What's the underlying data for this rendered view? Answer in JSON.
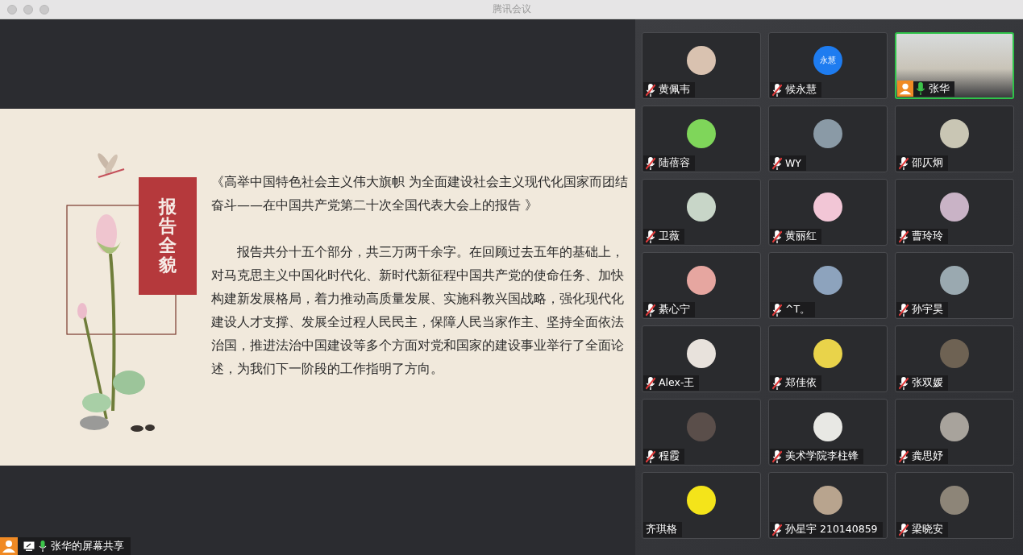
{
  "window": {
    "title": "腾讯会议"
  },
  "slide": {
    "heading": "报告全貌",
    "title": "《高举中国特色社会主义伟大旗帜 为全面建设社会主义现代化国家而团结奋斗——在中国共产党第二十次全国代表大会上的报告 》",
    "body": "报告共分十五个部分，共三万两千余字。在回顾过去五年的基础上，对马克思主义中国化时代化、新时代新征程中国共产党的使命任务、加快构建新发展格局，着力推动高质量发展、实施科教兴国战略，强化现代化建设人才支撑、发展全过程人民民主，保障人民当家作主、坚持全面依法治国，推进法治中国建设等多个方面对党和国家的建设事业举行了全面论述，为我们下一阶段的工作指明了方向。"
  },
  "share_label": {
    "text": "张华的屏幕共享",
    "mic_icon": true,
    "muted": false
  },
  "participants": [
    {
      "name": "黄佩韦",
      "mic_icon": true,
      "muted": true,
      "kind": "avatar",
      "color": "#d9c2b0",
      "speaking": false
    },
    {
      "name": "候永慧",
      "mic_icon": true,
      "muted": true,
      "kind": "avatar",
      "color": "#1e7cf0",
      "avatar_text": "永慧",
      "speaking": false
    },
    {
      "name": "张华",
      "mic_icon": true,
      "muted": false,
      "kind": "video",
      "speaking": true
    },
    {
      "name": "陆蓓容",
      "mic_icon": true,
      "muted": true,
      "kind": "avatar",
      "color": "#7fd65a",
      "speaking": false
    },
    {
      "name": "WY",
      "mic_icon": true,
      "muted": true,
      "kind": "avatar",
      "color": "#8a9aa6",
      "speaking": false
    },
    {
      "name": "邵仄炯",
      "mic_icon": true,
      "muted": true,
      "kind": "avatar",
      "color": "#c9c6b4",
      "speaking": false
    },
    {
      "name": "卫薇",
      "mic_icon": true,
      "muted": true,
      "kind": "avatar",
      "color": "#c8d6c8",
      "speaking": false
    },
    {
      "name": "黄丽红",
      "mic_icon": true,
      "muted": true,
      "kind": "avatar",
      "color": "#f2c6d6",
      "speaking": false
    },
    {
      "name": "曹玲玲",
      "mic_icon": true,
      "muted": true,
      "kind": "avatar",
      "color": "#c9b3c6",
      "speaking": false
    },
    {
      "name": "綦心宁",
      "mic_icon": true,
      "muted": true,
      "kind": "avatar",
      "color": "#e6a6a0",
      "speaking": false
    },
    {
      "name": "^T。",
      "mic_icon": true,
      "muted": true,
      "kind": "avatar",
      "color": "#8da3bd",
      "speaking": false
    },
    {
      "name": "孙宇昊",
      "mic_icon": true,
      "muted": true,
      "kind": "avatar",
      "color": "#9aa9b0",
      "speaking": false
    },
    {
      "name": "Alex-王",
      "mic_icon": true,
      "muted": true,
      "kind": "avatar",
      "color": "#e8e2dc",
      "speaking": false
    },
    {
      "name": "郑佳依",
      "mic_icon": true,
      "muted": true,
      "kind": "avatar",
      "color": "#e9d34a",
      "speaking": false
    },
    {
      "name": "张双媛",
      "mic_icon": true,
      "muted": true,
      "kind": "avatar",
      "color": "#6e6253",
      "speaking": false
    },
    {
      "name": "程霞",
      "mic_icon": true,
      "muted": true,
      "kind": "avatar",
      "color": "#5a4e4a",
      "speaking": false
    },
    {
      "name": "美术学院李柱锋",
      "mic_icon": true,
      "muted": true,
      "kind": "avatar",
      "color": "#e8e8e4",
      "speaking": false
    },
    {
      "name": "龚思妤",
      "mic_icon": true,
      "muted": true,
      "kind": "avatar",
      "color": "#a8a39c",
      "speaking": false
    },
    {
      "name": "齐琪格",
      "mic_icon": false,
      "kind": "avatar",
      "color": "#f4e41a",
      "speaking": false
    },
    {
      "name": "孙星宇 210140859",
      "mic_icon": true,
      "muted": true,
      "kind": "avatar",
      "color": "#b8a48e",
      "speaking": false
    },
    {
      "name": "梁晓安",
      "mic_icon": true,
      "muted": true,
      "kind": "avatar",
      "color": "#8d8578",
      "speaking": false
    }
  ]
}
